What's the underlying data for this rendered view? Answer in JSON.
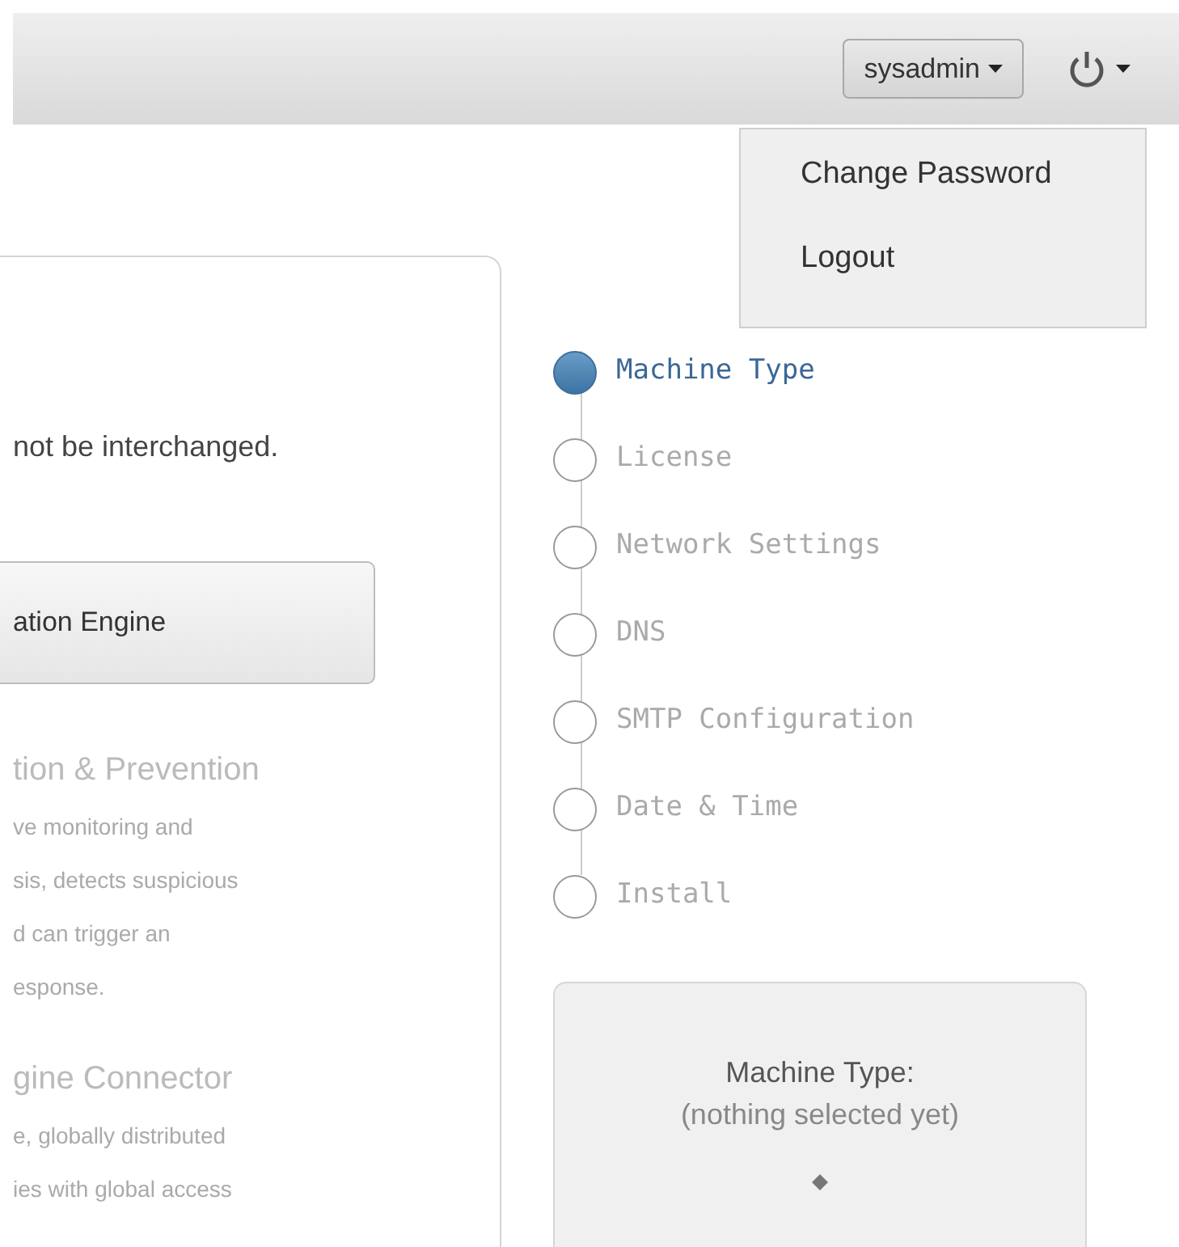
{
  "header": {
    "user_button": "sysadmin",
    "power_menu": {
      "open": true,
      "items": [
        "Change Password",
        "Logout"
      ]
    }
  },
  "card": {
    "notice": "not be interchanged.",
    "engine_button": "ation Engine",
    "options": [
      {
        "title": "tion & Prevention",
        "lines": [
          "ve monitoring and",
          "sis, detects suspicious",
          "d can trigger an",
          "esponse."
        ]
      },
      {
        "title": "gine Connector",
        "lines": [
          "e, globally distributed",
          "ies with global access"
        ]
      }
    ]
  },
  "steps": [
    {
      "label": "Machine Type",
      "selected": true
    },
    {
      "label": "License",
      "selected": false
    },
    {
      "label": "Network Settings",
      "selected": false
    },
    {
      "label": "DNS",
      "selected": false
    },
    {
      "label": "SMTP Configuration",
      "selected": false
    },
    {
      "label": "Date & Time",
      "selected": false
    },
    {
      "label": "Install",
      "selected": false
    }
  ],
  "summary": {
    "title": "Machine Type:",
    "value": "(nothing selected yet)"
  }
}
